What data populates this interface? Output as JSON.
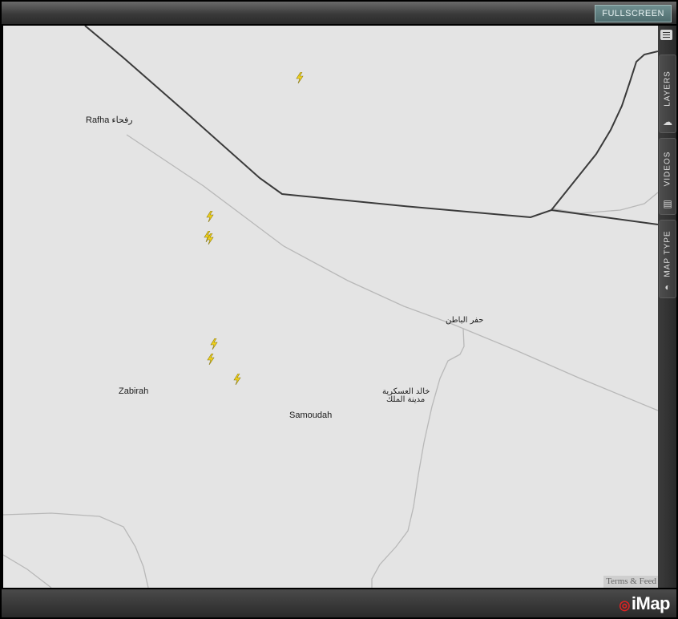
{
  "header": {
    "fullscreen_label": "FULLSCREEN"
  },
  "sidebar": {
    "tabs": [
      {
        "label": "LAYERS",
        "icon": "layers-icon"
      },
      {
        "label": "VIDEOS",
        "icon": "film-icon"
      },
      {
        "label": "MAP TYPE",
        "icon": "globe-icon"
      }
    ]
  },
  "map": {
    "places": [
      {
        "name": "Rafha رفحاء"
      },
      {
        "name": "حفر الباطن"
      },
      {
        "name": "Zabirah"
      },
      {
        "name": "Samoudah"
      },
      {
        "name": "خالد العسكرية"
      },
      {
        "name": "مدينة الملك"
      }
    ],
    "lightning_strikes": 7,
    "lightning_color": "#f2d21b",
    "border_color": "#3a3a3a",
    "road_color": "#b8b8b8"
  },
  "footer": {
    "terms": "Terms & Feed",
    "logo": "iMap"
  }
}
